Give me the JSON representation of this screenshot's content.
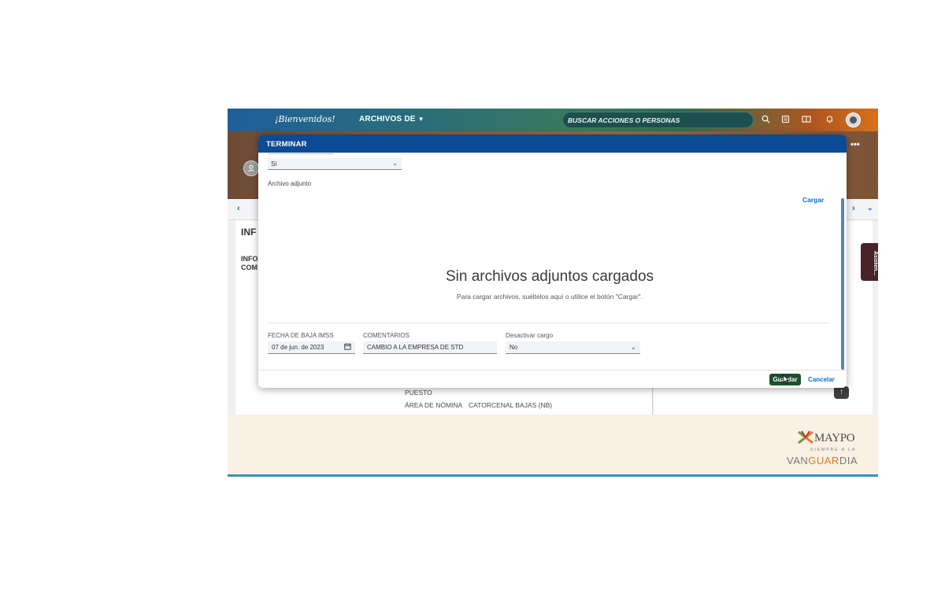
{
  "topbar": {
    "welcome": "¡Bienvenidos!",
    "module_menu": "ARCHIVOS DE",
    "search_placeholder": "BUSCAR ACCIONES O PERSONAS",
    "icons": [
      "search-icon",
      "catalog-icon",
      "book-icon",
      "bell-icon",
      "avatar"
    ]
  },
  "background": {
    "info_title": "INF",
    "info_sub_1": "INFO",
    "info_sub_2": "COM",
    "puesto_label": "PUESTO",
    "area_label": "ÁREA DE NÓMINA",
    "area_value": "CATORCENAL BAJAS (NB)",
    "assistant_tab": "Asisten..."
  },
  "modal": {
    "title": "TERMINAR",
    "first_select_value": "Sí",
    "attachment_label": "Archivo adjunto",
    "upload_link": "Cargar",
    "empty_title": "Sin archivos adjuntos cargados",
    "empty_hint": "Para cargar archivos, suéltelos aquí o utilice el botón \"Cargar\".",
    "fields": {
      "fecha_label": "FECHA DE BAJA IMSS",
      "fecha_value": "07 de jun. de 2023",
      "comentarios_label": "COMENTARIOS",
      "comentarios_value": "CAMBIO A LA EMPRESA DE STD",
      "desactivar_label": "Desactivar cargo",
      "desactivar_value": "No"
    },
    "save_button": "Guardar",
    "cancel_button": "Cancelar"
  },
  "footer": {
    "brand": "MAYPO",
    "tagline": "SIEMPRE A LA",
    "slogan_a": "VAN",
    "slogan_b": "GUAR",
    "slogan_c": "DIA"
  },
  "colors": {
    "header_blue": "#0b4a94",
    "link_blue": "#0b6ec4",
    "save_green": "#1c4f2f",
    "footer_bg": "#f8f1e4"
  }
}
